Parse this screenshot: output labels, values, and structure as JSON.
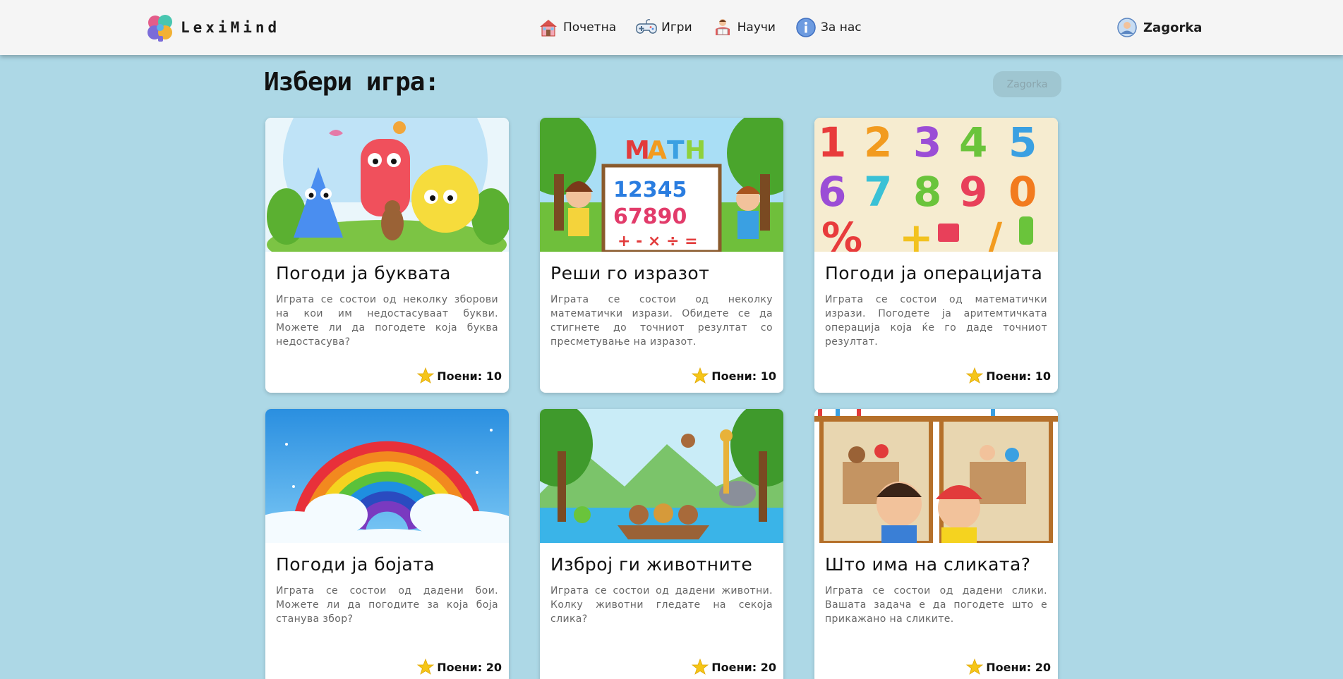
{
  "app": {
    "name": "LexiMind"
  },
  "nav": {
    "items": [
      {
        "label": "Почетна",
        "icon": "home-icon"
      },
      {
        "label": "Игри",
        "icon": "gamepad-icon"
      },
      {
        "label": "Научи",
        "icon": "study-icon"
      },
      {
        "label": "За нас",
        "icon": "info-icon"
      }
    ],
    "user": {
      "label": "Zagorka",
      "icon": "user-avatar-icon"
    }
  },
  "page": {
    "title": "Избери игра:",
    "user_pill": "Zagorka"
  },
  "games": [
    {
      "title": "Погоди ја буквата",
      "description": "Играта се состои од неколку зборови на кои им недостасуваат букви. Можете ли да погодете која буква недостасува?",
      "points": "Поени: 10",
      "image": "alphabet-letters-illustration"
    },
    {
      "title": "Реши го изразот",
      "description": "Играта се состои од неколку математички изрази. Обидете се да стигнете до точниот резултат со пресметување на изразот.",
      "points": "Поени: 10",
      "image": "math-board-kids-illustration"
    },
    {
      "title": "Погоди ја операцијата",
      "description": "Играта се состои од математички изрази. Погодете ја аритемтичката операција која ќе го даде точниот резултат.",
      "points": "Поени: 10",
      "image": "colorful-numbers-illustration"
    },
    {
      "title": "Погоди ја бојата",
      "description": "Играта се состои од дадени бои. Можете ли да погодите за која боја станува збор?",
      "points": "Поени: 20",
      "image": "rainbow-clouds-illustration"
    },
    {
      "title": "Изброј ги животните",
      "description": "Играта се состои од дадени животни. Колку животни гледате на секоја слика?",
      "points": "Поени: 20",
      "image": "jungle-animals-illustration"
    },
    {
      "title": "Што има на сликата?",
      "description": "Играта се состои од дадени слики. Вашата задача е да погодете што е прикажано на сликите.",
      "points": "Поени: 20",
      "image": "kids-toys-illustration"
    }
  ],
  "colors": {
    "page_background": "#add8e6",
    "navbar_background": "#f5f5f5",
    "star": "#f5c518"
  }
}
